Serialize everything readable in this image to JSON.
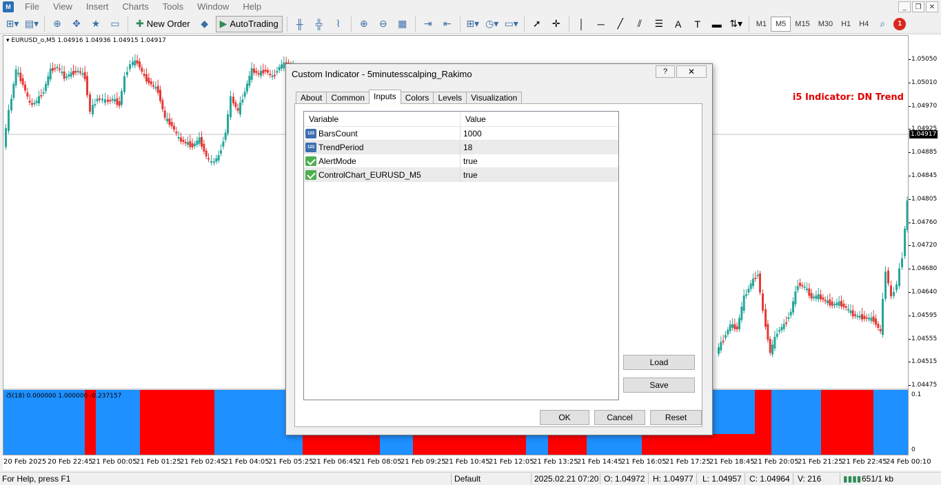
{
  "menu": [
    "File",
    "View",
    "Insert",
    "Charts",
    "Tools",
    "Window",
    "Help"
  ],
  "window_controls": [
    "minimize",
    "restore",
    "close"
  ],
  "toolbar": {
    "new_order": "New Order",
    "autotrading": "AutoTrading",
    "timeframes": [
      "M1",
      "M5",
      "M15",
      "M30",
      "H1",
      "H4"
    ],
    "active_timeframe": "M5",
    "notification_count": "1"
  },
  "chart": {
    "symbol_line": "EURUSD_o,M5  1.04916 1.04936 1.04915 1.04917",
    "trend_label": "i5 Indicator: DN Trend",
    "current_price": "1.04917",
    "price_labels": [
      "1.05050",
      "1.05010",
      "1.04970",
      "1.04925",
      "1.04885",
      "1.04845",
      "1.04805",
      "1.04760",
      "1.04720",
      "1.04680",
      "1.04640",
      "1.04595",
      "1.04555",
      "1.04515",
      "1.04475"
    ],
    "sub_label": "i5(18) 0.000000 1.000000 -0.237157",
    "sub_scale_top": "0.1",
    "sub_scale_bottom": "0",
    "time_labels": [
      "20 Feb 2025",
      "20 Feb 22:45",
      "21 Feb 00:05",
      "21 Feb 01:25",
      "21 Feb 02:45",
      "21 Feb 04:05",
      "21 Feb 05:25",
      "21 Feb 06:45",
      "21 Feb 08:05",
      "21 Feb 09:25",
      "21 Feb 10:45",
      "21 Feb 12:05",
      "21 Feb 13:25",
      "21 Feb 14:45",
      "21 Feb 16:05",
      "21 Feb 17:25",
      "21 Feb 18:45",
      "21 Feb 20:05",
      "21 Feb 21:25",
      "21 Feb 22:45",
      "24 Feb 00:10"
    ],
    "colors": {
      "up": "#26a69a",
      "down": "#e53935",
      "sub_up": "#1e90ff",
      "sub_down": "#ff0000"
    }
  },
  "dialog": {
    "title": "Custom Indicator - 5minutesscalping_Rakimo",
    "help": "?",
    "close": "✕",
    "tabs": [
      "About",
      "Common",
      "Inputs",
      "Colors",
      "Levels",
      "Visualization"
    ],
    "active_tab": "Inputs",
    "columns": [
      "Variable",
      "Value"
    ],
    "rows": [
      {
        "icon": "number-icon",
        "variable": "BarsCount",
        "value": "1000"
      },
      {
        "icon": "number-icon",
        "variable": "TrendPeriod",
        "value": "18"
      },
      {
        "icon": "boolean-icon",
        "variable": "AlertMode",
        "value": "true"
      },
      {
        "icon": "boolean-icon",
        "variable": "ControlChart_EURUSD_M5",
        "value": "true"
      }
    ],
    "buttons": {
      "load": "Load",
      "save": "Save",
      "ok": "OK",
      "cancel": "Cancel",
      "reset": "Reset"
    }
  },
  "status": {
    "help": "For Help, press F1",
    "profile": "Default",
    "datetime": "2025.02.21 07:20",
    "open": "O: 1.04972",
    "high": "H: 1.04977",
    "low": "L: 1.04957",
    "close": "C: 1.04964",
    "volume": "V: 216",
    "traffic": "651/1 kb"
  }
}
